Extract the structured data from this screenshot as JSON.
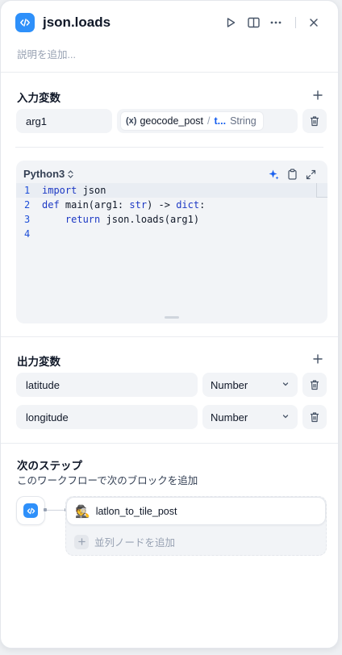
{
  "header": {
    "title": "json.loads",
    "description_placeholder": "説明を追加...",
    "icons": [
      "code-icon",
      "play-icon",
      "split-view-icon",
      "more-icon",
      "close-icon"
    ]
  },
  "input_vars": {
    "title": "入力変数",
    "items": [
      {
        "name": "arg1",
        "source_node": "geocode_post",
        "source_key": "t...",
        "type": "String"
      }
    ]
  },
  "editor": {
    "language": "Python3",
    "lines": [
      {
        "num": "1",
        "text": "import json"
      },
      {
        "num": "2",
        "text": "def main(arg1: str) -> dict:"
      },
      {
        "num": "3",
        "text": "    return json.loads(arg1)"
      },
      {
        "num": "4",
        "text": ""
      }
    ]
  },
  "output_vars": {
    "title": "出力変数",
    "items": [
      {
        "name": "latitude",
        "type": "Number"
      },
      {
        "name": "longitude",
        "type": "Number"
      }
    ]
  },
  "next_step": {
    "title": "次のステップ",
    "subtitle": "このワークフローで次のブロックを追加",
    "node_label": "latlon_to_tile_post",
    "node_emoji": "🕵️",
    "add_parallel_label": "並列ノードを追加"
  },
  "colors": {
    "accent": "#2e90fa",
    "link": "#155eef",
    "panel_bg": "#ffffff",
    "field_bg": "#f2f4f7"
  }
}
